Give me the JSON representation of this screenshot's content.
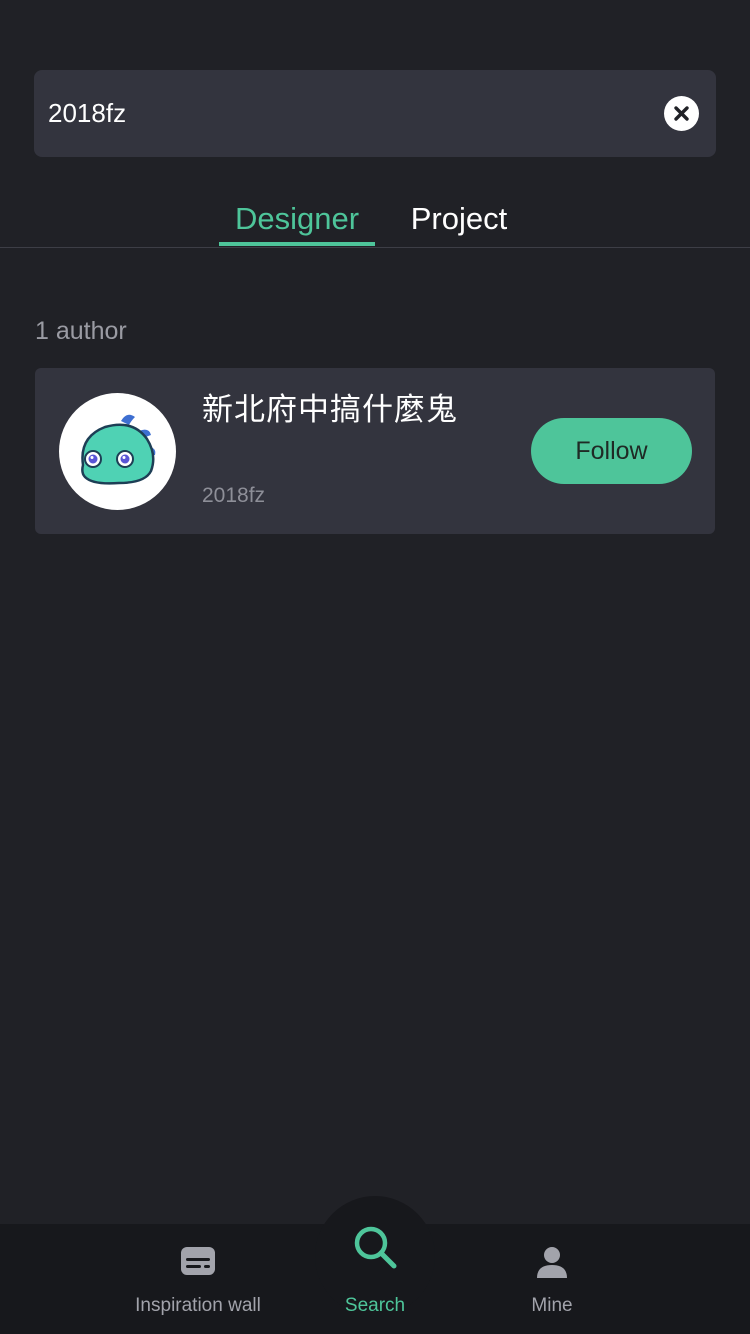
{
  "search": {
    "query": "2018fz",
    "clear_icon": "close-circle-icon"
  },
  "tabs": [
    {
      "label": "Designer",
      "active": true
    },
    {
      "label": "Project",
      "active": false
    }
  ],
  "results": {
    "count_label": "1 author"
  },
  "author": {
    "name": "新北府中搞什麼鬼",
    "handle": "2018fz",
    "avatar_icon": "dinosaur-avatar-icon",
    "follow_label": "Follow"
  },
  "bottom_nav": {
    "items": [
      {
        "label": "Inspiration wall",
        "icon": "message-card-icon",
        "active": false
      },
      {
        "label": "Search",
        "icon": "search-icon",
        "active": true
      },
      {
        "label": "Mine",
        "icon": "user-icon",
        "active": false
      }
    ]
  },
  "colors": {
    "background": "#202126",
    "surface": "#33343e",
    "accent": "#4ec59a",
    "nav_background": "#17181c",
    "muted_text": "#9a9ba3"
  }
}
